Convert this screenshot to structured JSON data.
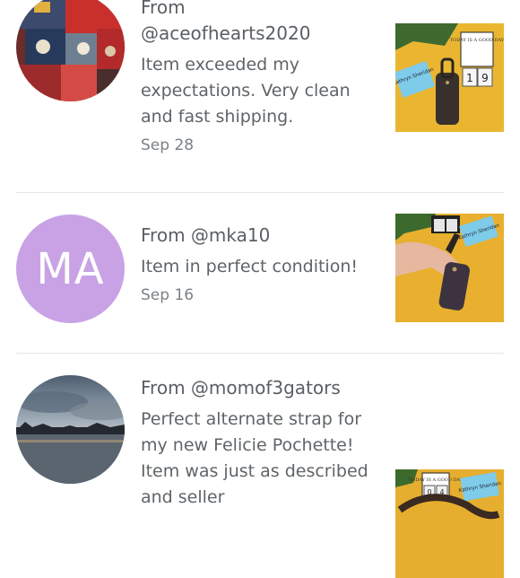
{
  "reviews": [
    {
      "from_prefix": "From",
      "username": "@aceofhearts2020",
      "text": "Item exceeded my expectations. Very clean and fast shipping.",
      "date": "Sep 28"
    },
    {
      "from_line": "From @mka10",
      "initials": "MA",
      "text": "Item in perfect condition!",
      "date": "Sep 16"
    },
    {
      "from_line": "From @momof3gators",
      "text": "Perfect alternate strap for my new Felicie Pochette! Item was just as described and seller"
    }
  ],
  "photo_text": {
    "card": "TODAY IS A GOOD DAY",
    "cal_a": "1",
    "cal_b": "9",
    "note": "Kathryn Sheridan",
    "cal_c": "0",
    "cal_d": "4"
  },
  "colors": {
    "avatar_initials_bg": "#c9a2e6",
    "text": "#5f6468",
    "date": "#7b8085",
    "divider": "#e8e8e8"
  }
}
